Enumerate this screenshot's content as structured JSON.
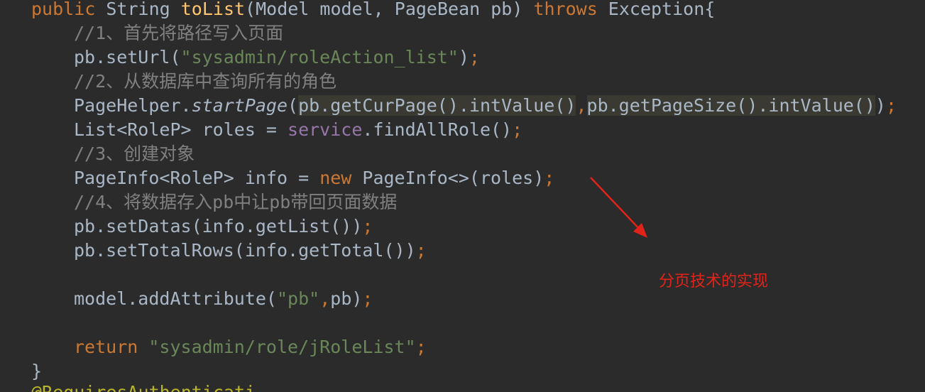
{
  "code": {
    "l1": {
      "kw_public": "public",
      "type": " String ",
      "method": "toList",
      "rest": "(Model model, PageBean pb) ",
      "kw_throws": "throws",
      "exc": " Exception{"
    },
    "l2": {
      "comment": "//1、首先将路径写入页面"
    },
    "l3": {
      "pre": "pb.setUrl(",
      "str": "\"sysadmin/roleAction_list\"",
      "post": ")",
      "semi": ";"
    },
    "l4": {
      "comment": "//2、从数据库中查询所有的角色"
    },
    "l5": {
      "pre": "PageHelper.",
      "italic": "startPage",
      "open": "(",
      "hl1": "pb.getCurPage().intValue()",
      "comma": ",",
      "hl2": "pb.getPageSize().intValue()",
      "close": ")",
      "semi": ";"
    },
    "l6": {
      "pre": "List<RoleP> roles = ",
      "field": "service",
      "post": ".findAllRole()",
      "semi": ";"
    },
    "l7": {
      "comment": "//3、创建对象"
    },
    "l8": {
      "pre": "PageInfo<RoleP> info = ",
      "kw": "new",
      "post": " PageInfo<>(roles)",
      "semi": ";"
    },
    "l9": {
      "comment": "//4、将数据存入pb中让pb带回页面数据"
    },
    "l10": {
      "pre": "pb.setDatas(info.getList())",
      "semi": ";"
    },
    "l11": {
      "pre": "pb.setTotalRows(info.getTotal())",
      "semi": ";"
    },
    "l13": {
      "pre": "model.addAttribute(",
      "str": "\"pb\"",
      "comma": ",",
      "post": "pb)",
      "semi": ";"
    },
    "l15": {
      "kw": "return",
      "str": " \"sysadmin/role/jRoleList\"",
      "semi": ";"
    },
    "l16": {
      "brace": "}"
    },
    "l17": {
      "annotation": "@RequiresAuthenticati"
    }
  },
  "annotation_note": {
    "text": "分页技术的实现",
    "color": "#e2231a"
  },
  "colors": {
    "background": "#2b2b2b",
    "keyword": "#cc7832",
    "method_decl": "#ffc66d",
    "string": "#6a8759",
    "comment": "#808080",
    "field": "#9876aa",
    "default_text": "#a9b7c6"
  }
}
